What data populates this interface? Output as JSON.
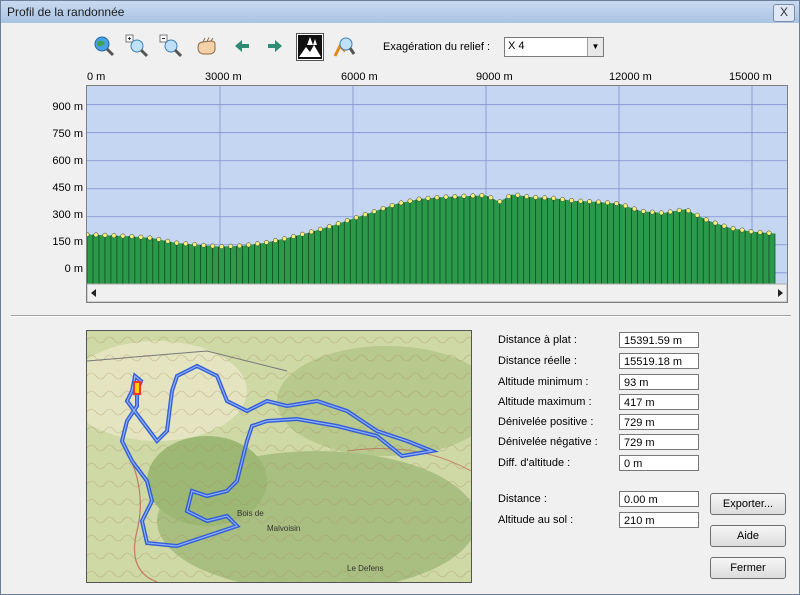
{
  "window": {
    "title": "Profil de la randonnée",
    "close_glyph": "X"
  },
  "toolbar": {
    "icons": [
      "globe-zoom-icon",
      "zoom-in-icon",
      "zoom-out-icon",
      "pan-hand-icon",
      "arrow-left-icon",
      "arrow-right-icon",
      "relief-trees-icon",
      "locate-point-icon"
    ],
    "relief_label": "Exagération du relief :",
    "relief_value": "X 4"
  },
  "chart_data": {
    "type": "area",
    "x_tick_labels": [
      "0 m",
      "3000 m",
      "6000 m",
      "9000 m",
      "12000 m",
      "15000 m"
    ],
    "y_tick_labels": [
      "900 m",
      "750 m",
      "600 m",
      "450 m",
      "300 m",
      "150 m",
      "0 m"
    ],
    "xlim": [
      0,
      15519
    ],
    "ylim": [
      -60,
      1000
    ],
    "x": [
      0,
      500,
      1000,
      1500,
      2000,
      2500,
      3000,
      3500,
      4000,
      4500,
      5000,
      5500,
      6000,
      6500,
      7000,
      7500,
      8000,
      8500,
      9000,
      9300,
      9600,
      10000,
      10500,
      11000,
      11500,
      12000,
      12500,
      13000,
      13500,
      14000,
      14500,
      15000,
      15519
    ],
    "y": [
      205,
      200,
      195,
      185,
      160,
      150,
      140,
      145,
      160,
      185,
      215,
      250,
      290,
      330,
      370,
      395,
      405,
      410,
      415,
      380,
      420,
      405,
      400,
      385,
      380,
      370,
      330,
      320,
      340,
      280,
      240,
      220,
      210
    ],
    "fill_color": "#2a9a4a",
    "background_color": "#c5d6f3",
    "marker_color": "#f3ef78",
    "grid": true
  },
  "stats": {
    "rows": [
      {
        "label": "Distance à plat :",
        "value": "15391.59 m"
      },
      {
        "label": "Distance réelle :",
        "value": "15519.18 m"
      },
      {
        "label": "Altitude minimum :",
        "value": "93 m"
      },
      {
        "label": "Altitude maximum :",
        "value": "417 m"
      },
      {
        "label": "Dénivelée positive :",
        "value": "729 m"
      },
      {
        "label": "Dénivelée négative :",
        "value": "729 m"
      },
      {
        "label": "Diff. d'altitude :",
        "value": "0 m"
      }
    ],
    "distance_label": "Distance :",
    "distance_value": "0.00 m",
    "ground_alt_label": "Altitude au sol :",
    "ground_alt_value": "210 m"
  },
  "buttons": {
    "export": "Exporter...",
    "help": "Aide",
    "close": "Fermer"
  },
  "map": {
    "labels": [
      "Bois de",
      "Malvoisin",
      "Le Defens"
    ]
  }
}
